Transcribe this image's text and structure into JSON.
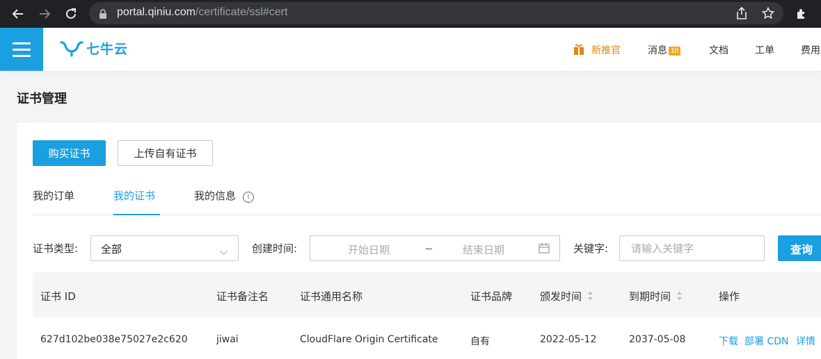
{
  "browser": {
    "url_host": "portal.qiniu.com",
    "url_path": "/certificate/ssl#cert"
  },
  "header": {
    "logo_text": "七牛云",
    "new_recommend": "新推官",
    "messages_label": "消息",
    "messages_count": "10",
    "docs": "文档",
    "tickets": "工单",
    "billing": "费用"
  },
  "page": {
    "title": "证书管理"
  },
  "actions": {
    "buy": "购买证书",
    "upload": "上传自有证书"
  },
  "tabs": [
    {
      "label": "我的订单"
    },
    {
      "label": "我的证书"
    },
    {
      "label": "我的信息"
    }
  ],
  "filters": {
    "type_label": "证书类型:",
    "type_value": "全部",
    "created_label": "创建时间:",
    "start_placeholder": "开始日期",
    "separator": "~",
    "end_placeholder": "结束日期",
    "keyword_label": "关键字:",
    "keyword_placeholder": "请输入关键字",
    "query": "查询"
  },
  "table": {
    "columns": [
      "证书 ID",
      "证书备注名",
      "证书通用名称",
      "证书品牌",
      "颁发时间",
      "到期时间",
      "操作"
    ],
    "rows": [
      {
        "id": "627d102be038e75027e2c620",
        "remark": "jiwai",
        "common_name": "CloudFlare Origin Certificate",
        "brand": "自有",
        "issued": "2022-05-12",
        "expires": "2037-05-08",
        "ops": [
          "下载",
          "部署 CDN",
          "详情"
        ]
      }
    ]
  },
  "colors": {
    "accent": "#1a9fe0",
    "badge": "#f5a623",
    "new": "#e8820c"
  }
}
